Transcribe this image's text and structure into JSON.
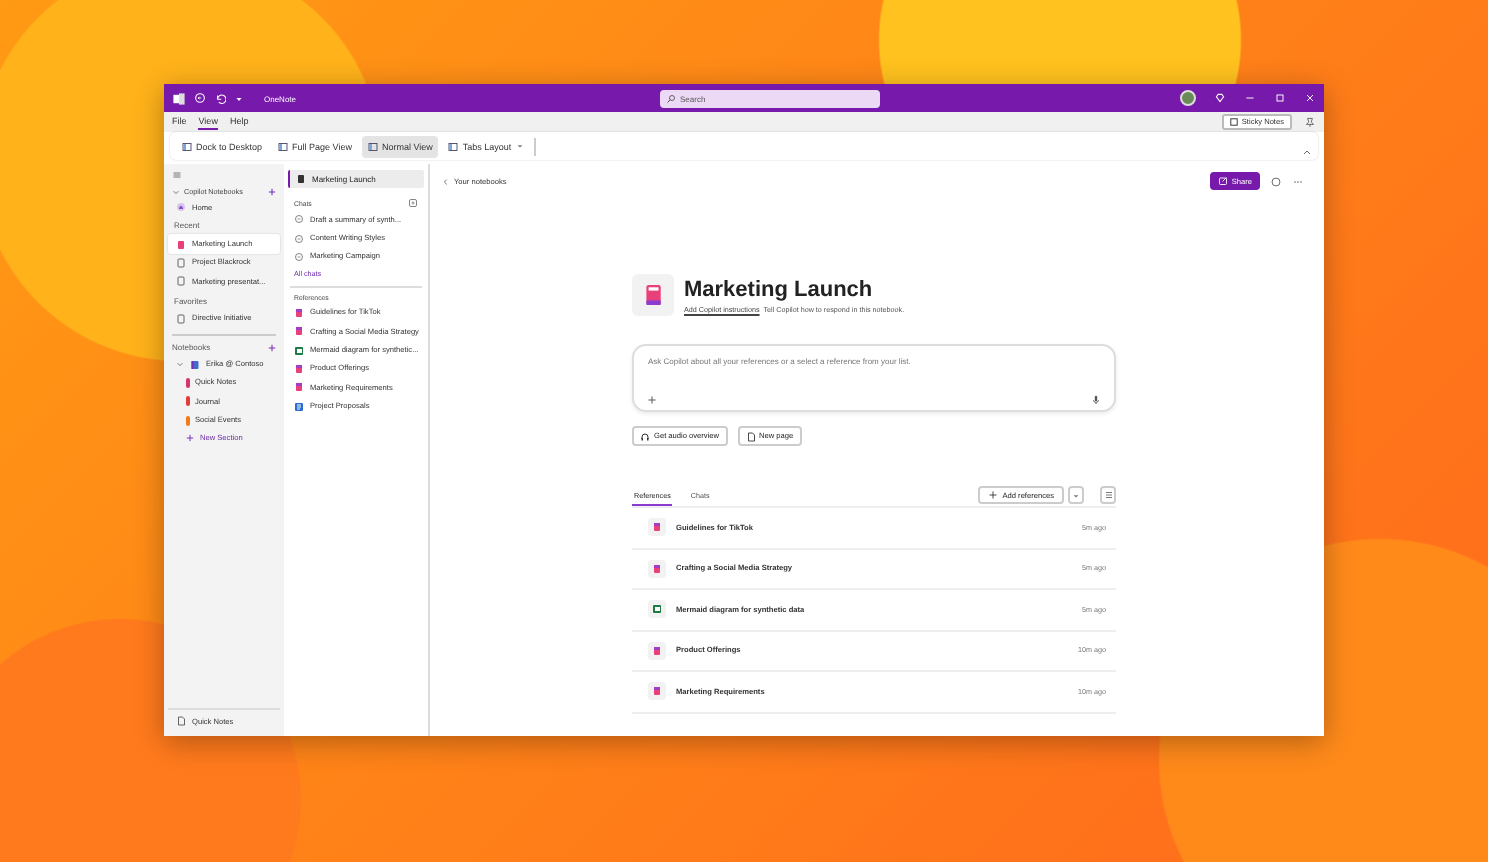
{
  "window": {
    "app_name": "OneNote",
    "search": {
      "placeholder": "Search"
    }
  },
  "menu": [
    {
      "label": "File",
      "selected": false
    },
    {
      "label": "View",
      "selected": true
    },
    {
      "label": "Help",
      "selected": false
    }
  ],
  "sticky_notes": "Sticky Notes",
  "ribbon": [
    {
      "label": "Dock to Desktop",
      "selected": false,
      "dropdown": false
    },
    {
      "label": "Full Page View",
      "selected": false,
      "dropdown": false
    },
    {
      "label": "Normal View",
      "selected": true,
      "dropdown": false
    },
    {
      "label": "Tabs Layout",
      "selected": false,
      "dropdown": true
    }
  ],
  "sidebar": {
    "copilot_heading": "Copilot Notebooks",
    "home": "Home",
    "recent_heading": "Recent",
    "recent": [
      {
        "label": "Marketing Launch",
        "selected": true
      },
      {
        "label": "Project Blackrock",
        "selected": false
      },
      {
        "label": "Marketing presentat...",
        "selected": false
      }
    ],
    "favorites_heading": "Favorites",
    "favorites": [
      {
        "label": "Directive Initiative",
        "selected": false
      }
    ],
    "notebooks_heading": "Notebooks",
    "notebook": {
      "label": "Erika @ Contoso",
      "expanded": true,
      "sections": [
        {
          "label": "Quick Notes",
          "color": "#d8336e"
        },
        {
          "label": "Journal",
          "color": "#e03c3c"
        },
        {
          "label": "Social Events",
          "color": "#f07b1c"
        }
      ]
    },
    "new_section": "New Section",
    "bottom": "Quick Notes"
  },
  "pages": {
    "current": "Marketing Launch",
    "chats_heading": "Chats",
    "chats": [
      {
        "label": "Draft a summary of synth..."
      },
      {
        "label": "Content Writing Styles"
      },
      {
        "label": "Marketing Campaign"
      }
    ],
    "all_chats": "All chats",
    "references_heading": "References",
    "references": [
      {
        "label": "Guidelines for TikTok",
        "kind": "page"
      },
      {
        "label": "Crafting a Social Media Strategy",
        "kind": "page"
      },
      {
        "label": "Mermaid diagram for synthetic...",
        "kind": "sheet"
      },
      {
        "label": "Product Offerings",
        "kind": "page"
      },
      {
        "label": "Marketing Requirements",
        "kind": "page"
      },
      {
        "label": "Project Proposals",
        "kind": "doc"
      }
    ]
  },
  "main": {
    "back": "Your notebooks",
    "share": "Share",
    "title": "Marketing Launch",
    "instructions_link": "Add Copilot instructions",
    "instructions_text": "Tell Copilot how to respond in this notebook.",
    "prompt": {
      "placeholder": "Ask Copilot about all your references or a select a reference from your list."
    },
    "actions": [
      {
        "label": "Get audio overview",
        "kind": "audio"
      },
      {
        "label": "New page",
        "kind": "page"
      }
    ],
    "tabs": [
      {
        "label": "References",
        "selected": true
      },
      {
        "label": "Chats",
        "selected": false
      }
    ],
    "add_references": "Add references",
    "rows": [
      {
        "label": "Guidelines for TikTok",
        "time": "5m ago",
        "kind": "page"
      },
      {
        "label": "Crafting a Social Media Strategy",
        "time": "5m ago",
        "kind": "page"
      },
      {
        "label": "Mermaid diagram for synthetic data",
        "time": "5m ago",
        "kind": "sheet"
      },
      {
        "label": "Product Offerings",
        "time": "10m ago",
        "kind": "page"
      },
      {
        "label": "Marketing Requirements",
        "time": "10m ago",
        "kind": "page"
      }
    ]
  }
}
